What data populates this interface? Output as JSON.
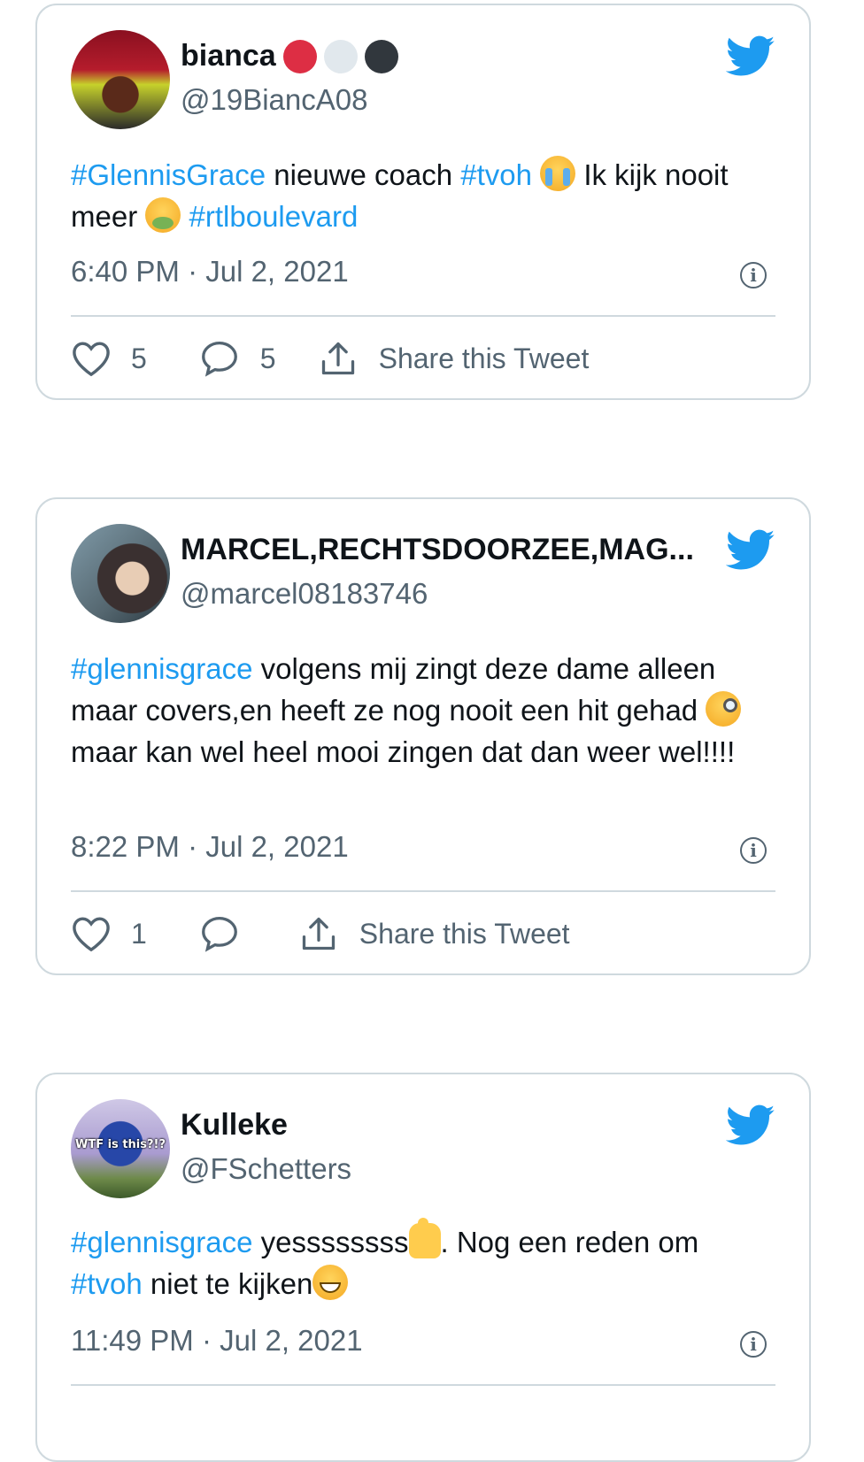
{
  "colors": {
    "accent": "#1d9bf0",
    "text": "#0f1419",
    "muted": "#536471",
    "border": "#cfd9de"
  },
  "tweets": [
    {
      "name": "bianca",
      "name_badges": [
        "red-circle",
        "white-circle",
        "black-circle"
      ],
      "handle": "@19BiancA08",
      "text_parts": [
        "#GlennisGrace",
        " nieuwe coach ",
        "#tvoh",
        " Ik kijk nooit meer ",
        "#rtlboulevard"
      ],
      "emojis": [
        "loudly-crying-face-emoji",
        "nauseated-face-emoji"
      ],
      "time": "6:40 PM · Jul 2, 2021",
      "likes": "5",
      "replies": "5",
      "share_label": "Share this Tweet"
    },
    {
      "name": "MARCEL,RECHTSDOORZEE,MAG...",
      "handle": "@marcel08183746",
      "text_parts": [
        "#glennisgrace",
        " volgens mij zingt deze dame alleen maar covers,en heeft ze nog nooit een hit gehad ",
        "maar kan wel heel mooi zingen dat dan weer wel!!!!"
      ],
      "emojis": [
        "face-with-monocle-emoji"
      ],
      "time": "8:22 PM · Jul 2, 2021",
      "likes": "1",
      "replies": "",
      "share_label": "Share this Tweet"
    },
    {
      "name": "Kulleke",
      "handle": "@FSchetters",
      "avatar_text": "WTF is this?!?",
      "text_parts": [
        "#glennisgrace",
        " yessssssss",
        ". Nog een reden om ",
        "#tvoh",
        " niet te kijken"
      ],
      "emojis": [
        "thumbs-up-emoji",
        "grinning-face-emoji"
      ],
      "time": "11:49 PM · Jul 2, 2021"
    }
  ]
}
